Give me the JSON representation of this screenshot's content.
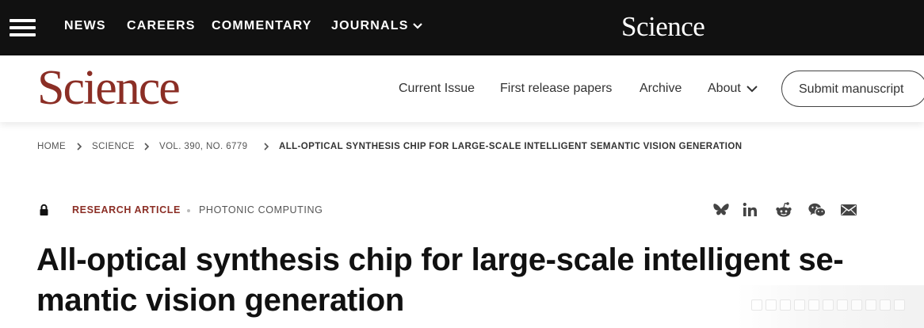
{
  "topbar": {
    "nav": [
      "NEWS",
      "CAREERS",
      "COMMENTARY",
      "JOURNALS"
    ],
    "logo": "Science"
  },
  "header": {
    "logo": "Science",
    "nav": [
      "Current Issue",
      "First release papers",
      "Archive",
      "About"
    ],
    "submit_label": "Submit manuscript"
  },
  "breadcrumb": [
    "HOME",
    "SCIENCE",
    "VOL. 390, NO. 6779",
    "ALL-OPTICAL SYNTHESIS CHIP FOR LARGE-SCALE INTELLIGENT SEMANTIC VISION GENERATION"
  ],
  "article": {
    "type": "RESEARCH ARTICLE",
    "topic": "PHOTONIC COMPUTING",
    "title_lines": [
      "All-optical synthesis chip for large-scale intelligent se-",
      "mantic vision generation"
    ]
  },
  "share_icons": [
    "bluesky-icon",
    "linkedin-icon",
    "reddit-icon",
    "wechat-icon",
    "email-icon"
  ],
  "colors": {
    "brand": "#8b2e25",
    "topbar": "#111111"
  }
}
